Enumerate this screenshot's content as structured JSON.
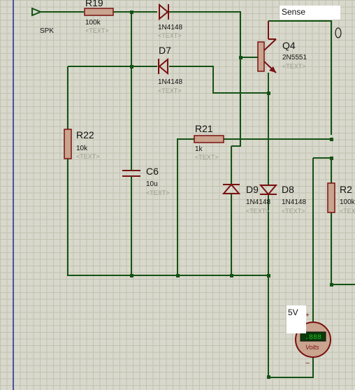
{
  "input": {
    "label": "SPK"
  },
  "sense_box": {
    "label": "Sense"
  },
  "supply_box": {
    "label": "5V"
  },
  "components": {
    "R19": {
      "ref": "R19",
      "value": "100k",
      "text": "<TEXT>"
    },
    "D_top": {
      "ref": "",
      "value": "1N4148",
      "text": "<TEXT>"
    },
    "D7": {
      "ref": "D7",
      "value": "1N4148",
      "text": "<TEXT>"
    },
    "Q4": {
      "ref": "Q4",
      "value": "2N5551",
      "text": "<TEXT>"
    },
    "R22": {
      "ref": "R22",
      "value": "10k",
      "text": "<TEXT>"
    },
    "R21": {
      "ref": "R21",
      "value": "1k",
      "text": "<TEXT>"
    },
    "C6": {
      "ref": "C6",
      "value": "10u",
      "text": "<TEXT>"
    },
    "D9": {
      "ref": "D9",
      "value": "1N4148",
      "text": "<TEXT>"
    },
    "D8": {
      "ref": "D8",
      "value": "1N4148",
      "text": "<TEXT>"
    },
    "R2x": {
      "ref": "R2",
      "value": "100k",
      "text": "<TEX"
    }
  },
  "voltmeter": {
    "display": ".888",
    "unit": "Volts",
    "plus": "+",
    "minus": "−"
  },
  "probe": {
    "label": "0"
  },
  "colors": {
    "wire": "#145214",
    "component": "#7a1010",
    "grid": "#c2c2b2",
    "background": "#d8d8cc",
    "lcd": "#1fbf1f"
  }
}
